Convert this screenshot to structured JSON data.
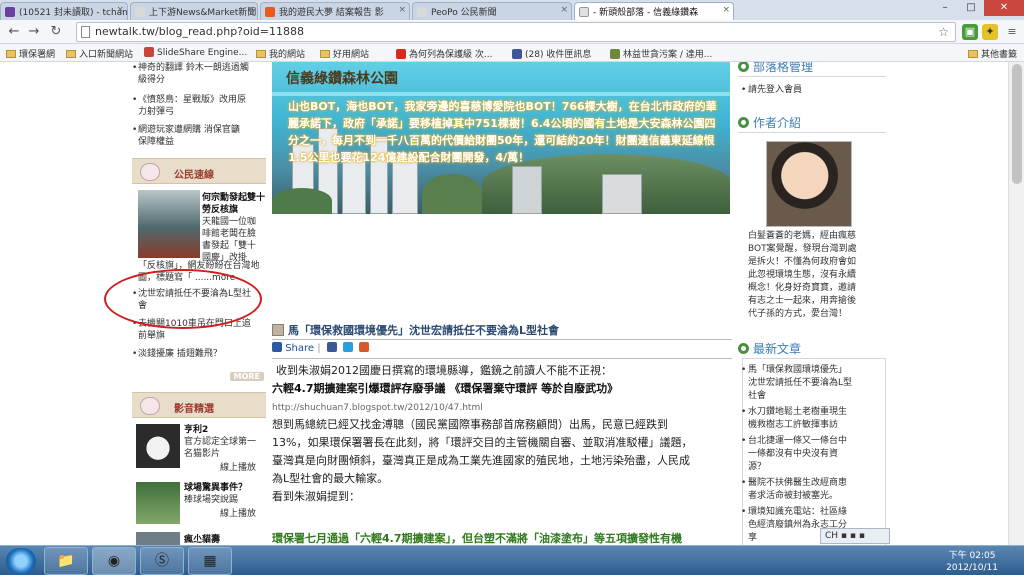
{
  "browser": {
    "tabs": [
      {
        "label": "(10521 封未讀取) - tchan"
      },
      {
        "label": "上下游News&Market新聞"
      },
      {
        "label": "我的遊民大夢 結案報告 影"
      },
      {
        "label": "PeoPo 公民新聞"
      },
      {
        "label": "- 新頭殼部落 - 信義綠鑽森"
      }
    ],
    "url": "newtalk.tw/blog_read.php?oid=11888",
    "bookmarks": [
      "環保署網",
      "入口新聞網站",
      "SlideShare Engine...",
      "我的網站",
      "好用網站",
      "為何列為保護級 次...",
      "(28) 收件匣訊息",
      "林益世貪污案 / 達用...",
      "其他書籤"
    ]
  },
  "left_sidebar": {
    "top_items": [
      "神奇的翻譯 鈴木一朗逃過觸",
      "級得分",
      "《憤怒鳥：星戰版》改用原",
      "力射彈弓",
      "網遊玩家遭網購 消保官籲",
      "保障權益"
    ],
    "citizen_box": {
      "title": "公民速線",
      "feature_title": "何宗勳發起雙十勞反核旗",
      "feature_text": [
        "天龍國一位咖",
        "啡館老闆在臉",
        "書發起「雙十",
        "國慶」改掛",
        "「反核旗」，網友紛紛在台灣地",
        "圖，標題寫「 ......more"
      ],
      "list": [
        "沈世宏請抵任不要淪為L型社",
        "會",
        "去機關1010車吊在門口上追",
        "前舉旗",
        "淡錢擾廉 插翅難飛？"
      ],
      "more": "MORE"
    },
    "video_box": {
      "title": "影音精選",
      "v1_title": "亨利2",
      "v1_desc": [
        "官方認定全球第一",
        "名猫影片"
      ],
      "v1_link": "線上播放",
      "v2_title": "球場驚異事件？",
      "v2_desc": [
        "棒球場突說踢"
      ],
      "v2_link": "線上播放",
      "v3_title": "瘋尐貓壽"
    }
  },
  "main": {
    "banner_title": "信義綠鑽森林公園",
    "banner_text": "山也BOT，海也BOT，我家旁邊的喜慈博愛院也BOT！766棵大樹，在台北市政府的華麗承諾下，政府「承諾」要移植掉其中751棵樹！6.4公頃的國有土地是大安森林公園四分之一，每月不到一千八百萬的代價給財團50年，還可結約20年！財團連信義東延線恨1.5公里也要花124億建設配合財團開發，4/萬！",
    "post_title": "馬「環保救國環境優先」沈世宏請抵任不要淪為L型社會",
    "share_label": "Share",
    "para1": "收到朱淑娟2012國慶日撰寫的環境縣導，鑑鏡之前讀人不能不正視：",
    "bold_line": "六輕4.7期擴建案引爆環評存廢爭議 《環保署棄守環評 等於自廢武功》",
    "source_url": "http://shuchuan7.blogspot.tw/2012/10/47.html",
    "para2": [
      "想到馬總統已經又找金溥聰（國民黨國際事務部首席務顧問）出馬，民意已經跌到",
      "13%，如果環保署署長在此刻，將「環評交目的主管機關自審、並取消准駁權」議題，",
      "臺灣真是向財團傾斜，臺灣真正是成為工業先進國家的殖民地，土地污染殆盡，人民成",
      "為L型社會的最大輸家。"
    ],
    "para3": "看到朱淑娟提到：",
    "para4": "環保署七月通過「六輕4.7期擴建案」，但台塑不滿將「油漆塗布」等五項擴發性有機"
  },
  "right_sidebar": {
    "blog_admin_title": "部落格管理",
    "login_link": "請先登入會員",
    "author_title": "作者介紹",
    "author_text": [
      "白髮蒼蒼的老媽，經由瘋慈",
      "BOT案覺醒，發現台灣到處",
      "是拆火！不懂為何政府會如",
      "此忽視環境生態，沒有永續",
      "概念！化身好奇寶寶，邀請",
      "有志之士一起來，用奔搶後",
      "代子孫的方式，愛台灣！"
    ],
    "latest_title": "最新文章",
    "latest": [
      [
        "馬「環保救國環境優先」",
        "沈世宏請抵任不要淪為L型",
        "社會"
      ],
      [
        "水刀鑽地鬆土老樹重現生",
        "機救樹志工許敏揮事訪"
      ],
      [
        "台北捷運一條又一條台中",
        "一條都沒有中央沒有資",
        "源？"
      ],
      [
        "醫院不扶佛醫生改經商患",
        "者求活命被封被塞光。"
      ],
      [
        "環境知識充電站：社區綠",
        "色經濟廢鎮州為永志工分",
        "享"
      ]
    ]
  },
  "taskbar": {
    "ime": "CH",
    "time": "下午 02:05",
    "date": "2012/10/11"
  },
  "colors": {
    "accent": "#3d7db0",
    "annotation": "#d01d1d",
    "sidebar_head": "#e7ddc9"
  }
}
